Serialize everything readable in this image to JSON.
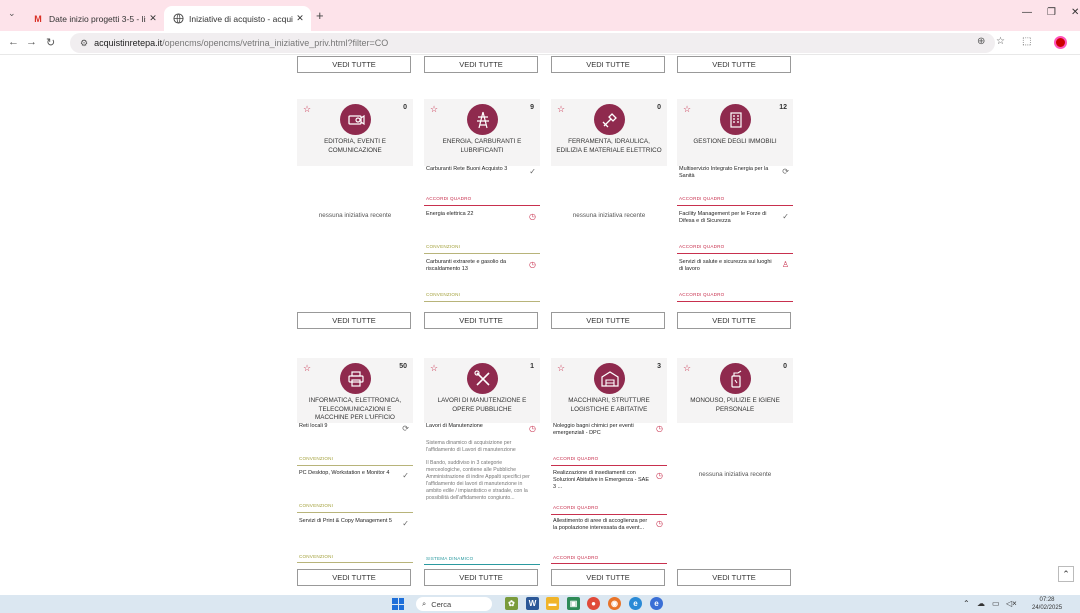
{
  "browser": {
    "tabs": [
      {
        "title": "Date inizio progetti 3-5 - lisa.sc",
        "favicon": "M",
        "active": false
      },
      {
        "title": "Iniziative di acquisto - acquisti",
        "favicon": "globe",
        "active": true
      }
    ],
    "new_tab": "+",
    "url": {
      "host": "acquistinretepa.it",
      "path": "/opencms/opencms/vetrina_iniziative_priv.html?filter=CO"
    }
  },
  "page": {
    "vedi_label": "VEDI TUTTE",
    "nessuna": "nessuna iniziativa recente",
    "tags": {
      "aq": "ACCORDI QUADRO",
      "cv": "CONVENZIONI",
      "sd": "SISTEMA DINAMICO"
    },
    "categories": [
      {
        "name": "EDITORIA, EVENTI E COMUNICAZIONE",
        "count": "0",
        "icon": "projector-icon",
        "items": []
      },
      {
        "name": "ENERGIA, CARBURANTI E LUBRIFICANTI",
        "count": "9",
        "icon": "energy-tower-icon",
        "items": [
          {
            "title": "Carburanti Rete Buoni Acquisto 3",
            "type": "aq",
            "mark": "ok"
          },
          {
            "title": "Energia elettrica 22",
            "type": "cv",
            "mark": "clock"
          },
          {
            "title": "Carburanti extrarete e gasolio da riscaldamento 13",
            "type": "cv",
            "mark": "clock"
          }
        ]
      },
      {
        "name": "FERRAMENTA, IDRAULICA, EDILIZIA E MATERIALE ELETTRICO",
        "count": "0",
        "icon": "tools-icon",
        "items": []
      },
      {
        "name": "GESTIONE DEGLI IMMOBILI",
        "count": "12",
        "icon": "building-icon",
        "items": [
          {
            "title": "Multiservizio Integrato Energia per la Sanità",
            "type": "aq",
            "mark": "loading"
          },
          {
            "title": "Facility Management per le Forze di Difesa e di Sicurezza",
            "type": "aq",
            "mark": "ok"
          },
          {
            "title": "Servizi di salute e sicurezza sui luoghi di lavoro",
            "type": "aq",
            "mark": "person"
          }
        ]
      },
      {
        "name": "INFORMATICA, ELETTRONICA, TELECOMUNICAZIONI E MACCHINE PER L'UFFICIO",
        "count": "50",
        "icon": "printer-icon",
        "items": [
          {
            "title": "Reti locali 9",
            "type": "cv",
            "mark": "loading"
          },
          {
            "title": "PC Desktop, Workstation e Monitor 4",
            "type": "cv",
            "mark": "ok"
          },
          {
            "title": "Servizi di Print & Copy Management 5",
            "type": "cv",
            "mark": "ok"
          }
        ]
      },
      {
        "name": "LAVORI DI MANUTENZIONE E OPERE PUBBLICHE",
        "count": "1",
        "icon": "wrench-screwdriver-icon",
        "items": [
          {
            "title": "Lavori di Manutenzione",
            "type": "sd",
            "mark": "clock",
            "desc1": "Sistema dinamico di acquisizione per l'affidamento di Lavori di manutenzione",
            "desc2": "Il Bando, suddiviso in 3 categorie merceologiche, contiene alle Pubbliche Amministrazione di indire Appalti specifici per l'affidamento dei lavori di manutenzione in ambito edile / impiantistico e stradale, con la possibilità dell'affidamento congiunto..."
          }
        ]
      },
      {
        "name": "MACCHINARI, STRUTTURE LOGISTICHE E ABITATIVE",
        "count": "3",
        "icon": "structure-icon",
        "items": [
          {
            "title": "Noleggio bagni chimici per eventi emergenziali - DPC",
            "type": "aq",
            "mark": "clock"
          },
          {
            "title": "Realizzazione di insediamenti con Soluzioni Abitative in Emergenza - SAE 3 ...",
            "type": "aq",
            "mark": "clock"
          },
          {
            "title": "Allestimento di aree di accoglienza per la popolazione interessata da event...",
            "type": "aq",
            "mark": "clock"
          }
        ]
      },
      {
        "name": "MONOUSO, PULIZIE E IGIENE PERSONALE",
        "count": "0",
        "icon": "cleaning-icon",
        "items": []
      }
    ]
  },
  "taskbar": {
    "search": "Cerca",
    "time": "07:28",
    "date": "24/02/2025"
  },
  "colors": {
    "accent": "#8f2a4e",
    "aq": "#c8304e",
    "cv": "#a3a03a",
    "sd": "#2a9aa0"
  }
}
